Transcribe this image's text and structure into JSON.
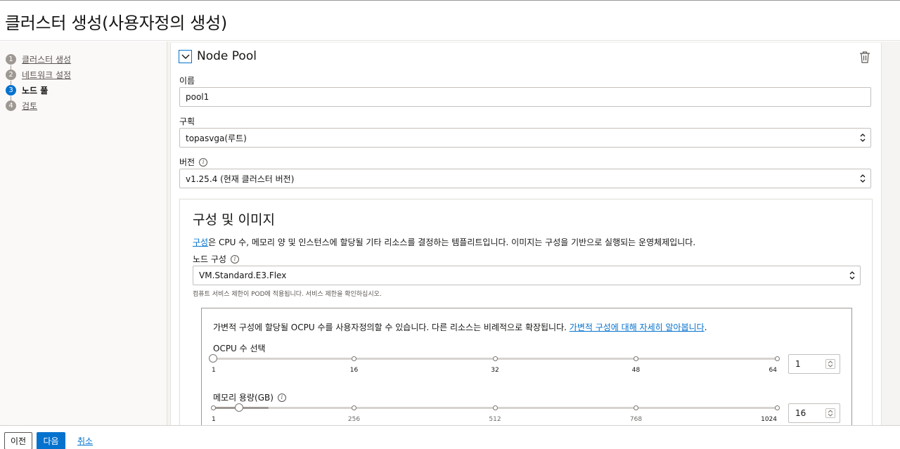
{
  "header": {
    "title": "클러스터 생성(사용자정의 생성)"
  },
  "steps": [
    {
      "num": "1",
      "label": "클러스터 생성"
    },
    {
      "num": "2",
      "label": "네트워크 설정"
    },
    {
      "num": "3",
      "label": "노드 풀"
    },
    {
      "num": "4",
      "label": "검토"
    }
  ],
  "nodepool": {
    "title": "Node Pool",
    "name_label": "이름",
    "name_value": "pool1",
    "compartment_label": "구획",
    "compartment_value": "topasvga(루트)",
    "version_label": "버전",
    "version_value": "v1.25.4 (현재 클러스터 버전)"
  },
  "shape": {
    "title": "구성 및 이미지",
    "desc_link": "구성",
    "desc_rest": "은 CPU 수, 메모리 양 및 인스턴스에 할당될 기타 리소스를 결정하는 템플리트입니다. 이미지는 구성을 기반으로 실행되는 운영체제입니다.",
    "node_shape_label": "노드 구성",
    "node_shape_value": "VM.Standard.E3.Flex",
    "hint": "컴퓨트 서비스 제한이 POD에 적용됩니다. 서비스 제한을 확인하십시오."
  },
  "flex": {
    "desc": "가변적 구성에 할당될 OCPU 수를 사용자정의할 수 있습니다. 다른 리소스는 비례적으로 확장됩니다.",
    "link": "가변적 구성에 대해 자세히 알아봅니다",
    "period": ".",
    "ocpu_label": "OCPU 수 선택",
    "ocpu_ticks": [
      "1",
      "16",
      "32",
      "48",
      "64"
    ],
    "ocpu_value": "1",
    "ocpu_min": 1,
    "ocpu_max": 64,
    "mem_label": "메모리 용량(GB)",
    "mem_ticks": [
      "1",
      "256",
      "512",
      "768",
      "1024"
    ],
    "mem_value": "16",
    "mem_min": 1,
    "mem_max": 1024,
    "mem_range_low": 1,
    "mem_range_high": 64
  },
  "footer": {
    "prev": "이전",
    "next": "다음",
    "cancel": "취소"
  },
  "colors": {
    "accent": "#0572ce",
    "text": "#161513",
    "muted": "#9e9892"
  }
}
